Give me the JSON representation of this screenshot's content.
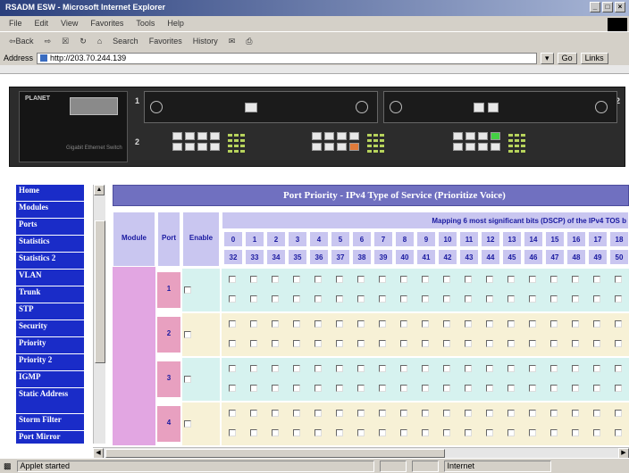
{
  "window": {
    "title": "RSADM ESW - Microsoft Internet Explorer",
    "buttons": [
      "_",
      "□",
      "×"
    ]
  },
  "menu": [
    "File",
    "Edit",
    "View",
    "Favorites",
    "Tools",
    "Help"
  ],
  "toolbar": {
    "back": "⇦Back",
    "forward": "⇨",
    "search": "Search",
    "favorites": "Favorites",
    "history": "History"
  },
  "address": {
    "label": "Address",
    "url": "http://203.70.244.139",
    "go": "Go",
    "links": "Links"
  },
  "device": {
    "brand": "PLANET",
    "slot1": "1",
    "slot2": "2",
    "row2": "2",
    "caption": "Gigabit Ethernet Switch"
  },
  "sidebar": {
    "items": [
      "Home",
      "Modules",
      "Ports",
      "Statistics",
      "Statistics 2",
      "VLAN",
      "Trunk",
      "STP",
      "Security",
      "Priority",
      "Priority 2",
      "IGMP",
      "Static Address",
      "Storm Filter",
      "Port Mirror"
    ]
  },
  "panel": {
    "title": "Port Priority - IPv4 Type of Service (Prioritize Voice)",
    "mapping_label": "Mapping 6 most significant bits (DSCP) of the IPv4 TOS b",
    "col_module": "Module",
    "col_port": "Port",
    "col_enable": "Enable",
    "row1": [
      "0",
      "1",
      "2",
      "3",
      "4",
      "5",
      "6",
      "7",
      "8",
      "9",
      "10",
      "11",
      "12",
      "13",
      "14",
      "15",
      "16",
      "17",
      "18"
    ],
    "row2": [
      "32",
      "33",
      "34",
      "35",
      "36",
      "37",
      "38",
      "39",
      "40",
      "41",
      "42",
      "43",
      "44",
      "45",
      "46",
      "47",
      "48",
      "49",
      "50"
    ],
    "ports": [
      "1",
      "2",
      "3",
      "4"
    ],
    "band_colors": [
      "#d6f2ef",
      "#f7f1d6",
      "#d6f2ef",
      "#f7f1d6"
    ]
  },
  "status": {
    "text": "Applet started",
    "zone": "Internet"
  }
}
